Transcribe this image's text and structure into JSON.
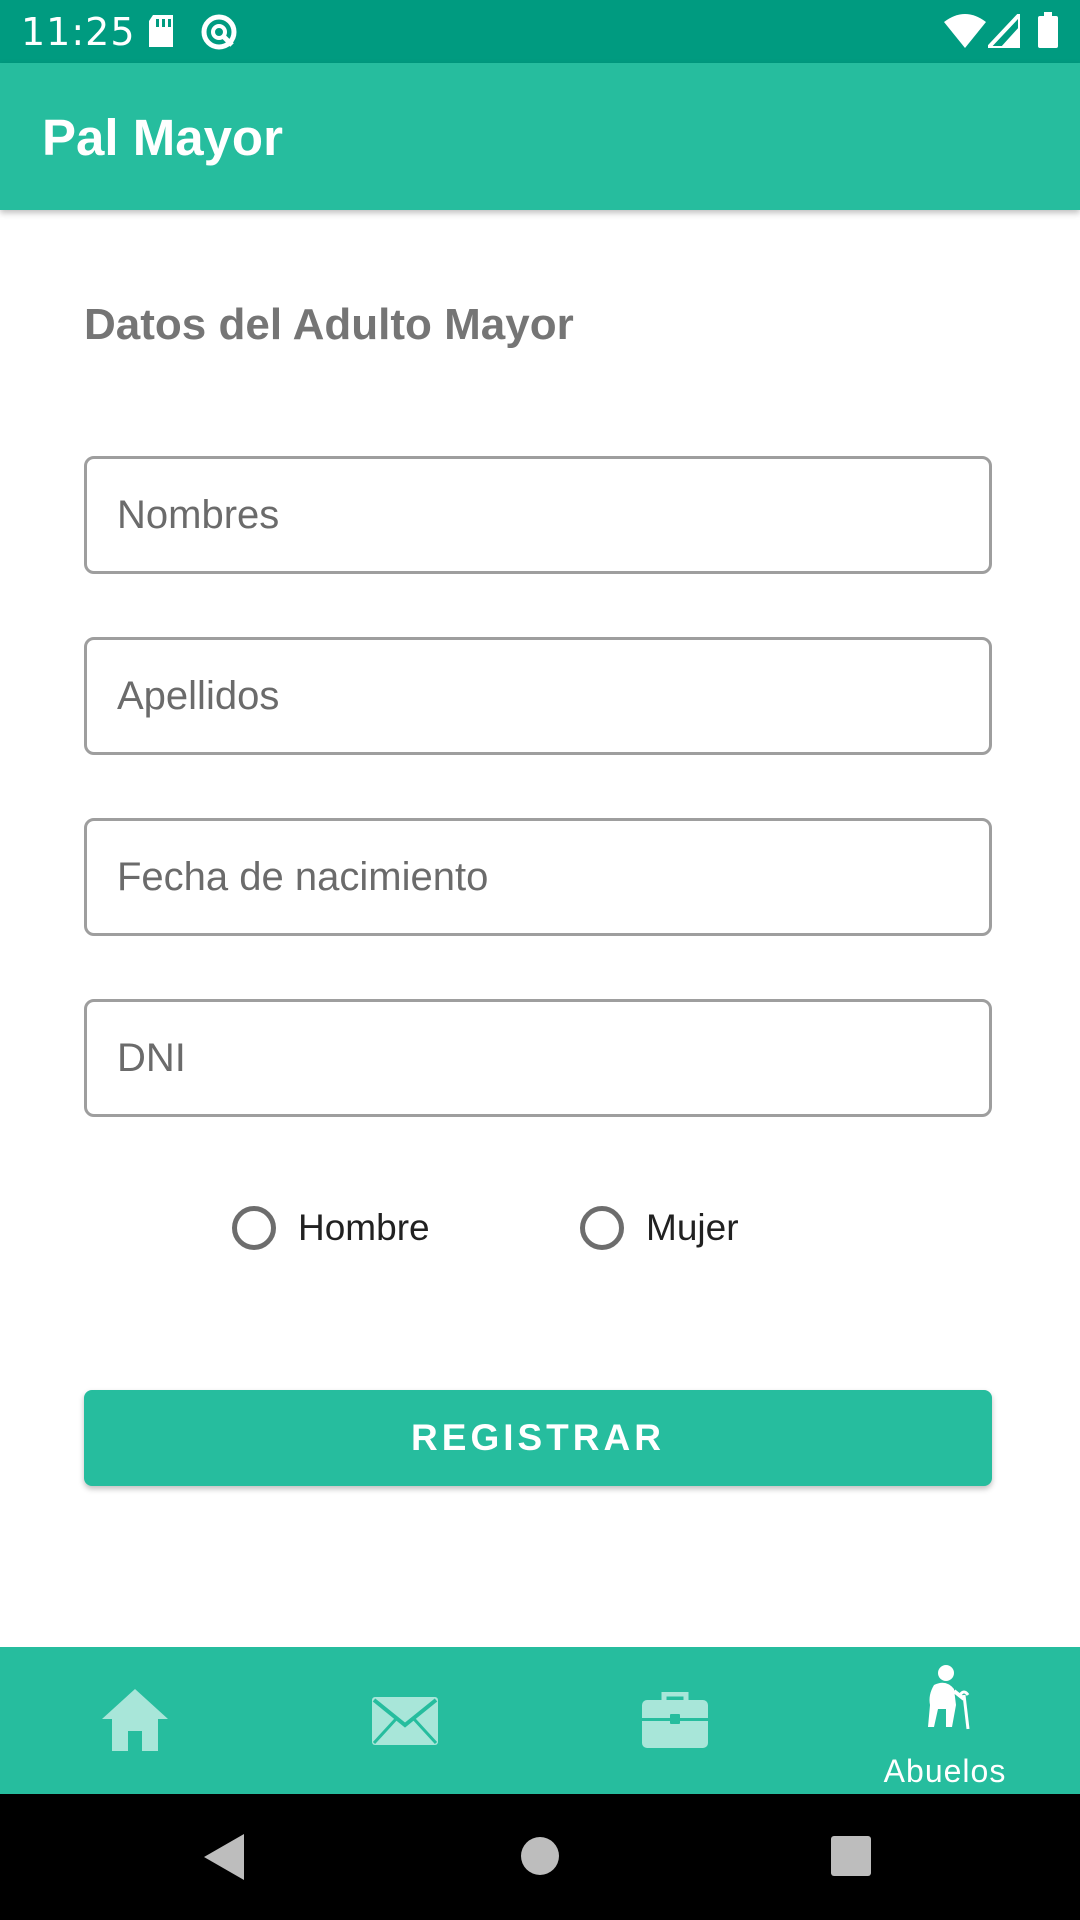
{
  "status_bar": {
    "time": "11:25",
    "icons": [
      "sd-card-icon",
      "sync-circle-icon",
      "wifi-icon",
      "cell-signal-icon",
      "battery-icon"
    ]
  },
  "app_bar": {
    "title": "Pal Mayor"
  },
  "form": {
    "section_title": "Datos del Adulto Mayor",
    "fields": [
      {
        "name": "nombres",
        "placeholder": "Nombres",
        "value": ""
      },
      {
        "name": "apellidos",
        "placeholder": "Apellidos",
        "value": ""
      },
      {
        "name": "fecha_nacimiento",
        "placeholder": "Fecha de nacimiento",
        "value": ""
      },
      {
        "name": "dni",
        "placeholder": "DNI",
        "value": ""
      }
    ],
    "gender_options": [
      {
        "label": "Hombre",
        "selected": false
      },
      {
        "label": "Mujer",
        "selected": false
      }
    ],
    "submit_label": "REGISTRAR"
  },
  "bottom_nav": {
    "items": [
      {
        "icon": "home-icon",
        "label": "",
        "active": false
      },
      {
        "icon": "mail-icon",
        "label": "",
        "active": false
      },
      {
        "icon": "briefcase-icon",
        "label": "",
        "active": false
      },
      {
        "icon": "elderly-person-icon",
        "label": "Abuelos",
        "active": true
      }
    ]
  },
  "system_nav": {
    "buttons": [
      "back-icon",
      "home-circle-icon",
      "recents-icon"
    ]
  },
  "colors": {
    "status_bar": "#009b80",
    "primary": "#26bd9e",
    "inactive_icon": "#a8e6d9",
    "title_text": "#757575"
  }
}
